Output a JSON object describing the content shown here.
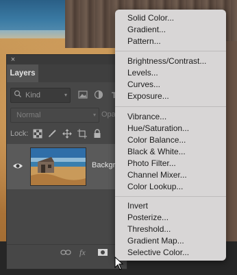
{
  "panel": {
    "close_symbol": "×",
    "tab_label": "Layers",
    "kind_label": "Kind",
    "blend_mode": "Normal",
    "opacity_label": "Opa",
    "lock_label": "Lock:",
    "layer": {
      "name": "Backgr"
    }
  },
  "menu": {
    "group1": [
      "Solid Color...",
      "Gradient...",
      "Pattern..."
    ],
    "group2": [
      "Brightness/Contrast...",
      "Levels...",
      "Curves...",
      "Exposure..."
    ],
    "group3": [
      "Vibrance...",
      "Hue/Saturation...",
      "Color Balance...",
      "Black & White...",
      "Photo Filter...",
      "Channel Mixer...",
      "Color Lookup..."
    ],
    "group4": [
      "Invert",
      "Posterize...",
      "Threshold...",
      "Gradient Map...",
      "Selective Color..."
    ]
  },
  "icons": {
    "close": "close-icon",
    "search": "search-icon",
    "eye": "eye-icon",
    "link": "link-icon",
    "fx": "fx-icon",
    "mask": "mask-icon",
    "lock_pixels": "checkerboard-icon",
    "lock_paint": "brush-icon",
    "lock_move": "move-icon",
    "lock_artboard": "artboard-icon",
    "lock_all": "lock-icon",
    "pointer": "arrow-cursor-icon"
  },
  "colors": {
    "panel_bg": "#474747",
    "menu_bg": "#d8d6d6",
    "selected_layer": "#5a5a5a"
  }
}
